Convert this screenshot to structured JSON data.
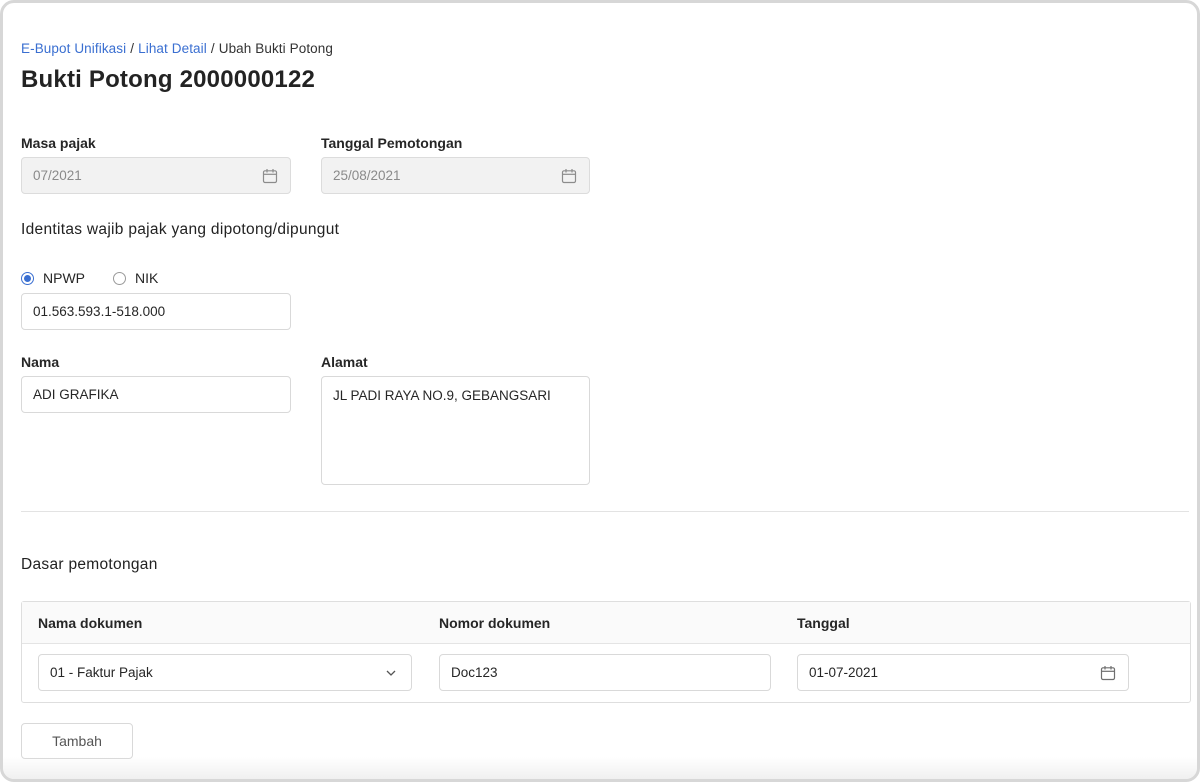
{
  "breadcrumb": {
    "items": [
      {
        "label": "E-Bupot Unifikasi",
        "link": true
      },
      {
        "label": "Lihat Detail",
        "link": true
      },
      {
        "label": "Ubah Bukti Potong",
        "link": false
      }
    ],
    "separator": "/"
  },
  "page": {
    "title": "Bukti Potong 2000000122"
  },
  "masa_pajak": {
    "label": "Masa pajak",
    "value": "07/2021",
    "icon": "calendar-icon"
  },
  "tanggal_pemotongan": {
    "label": "Tanggal Pemotongan",
    "value": "25/08/2021",
    "icon": "calendar-icon"
  },
  "identitas": {
    "title": "Identitas wajib pajak yang dipotong/dipungut",
    "options": [
      {
        "label": "NPWP",
        "selected": true
      },
      {
        "label": "NIK",
        "selected": false
      }
    ],
    "id_value": "01.563.593.1-518.000"
  },
  "nama": {
    "label": "Nama",
    "value": "ADI GRAFIKA"
  },
  "alamat": {
    "label": "Alamat",
    "value": "JL PADI RAYA NO.9, GEBANGSARI"
  },
  "dasar": {
    "title": "Dasar pemotongan",
    "columns": [
      "Nama dokumen",
      "Nomor dokumen",
      "Tanggal"
    ],
    "row": {
      "nama_dokumen": "01 - Faktur Pajak",
      "nomor_dokumen": "Doc123",
      "tanggal": "01-07-2021"
    }
  },
  "actions": {
    "add_label": "Tambah"
  },
  "colors": {
    "accent": "#3a6fd1",
    "disabled_bg": "#f2f2f2",
    "border": "#d9d9d9"
  }
}
